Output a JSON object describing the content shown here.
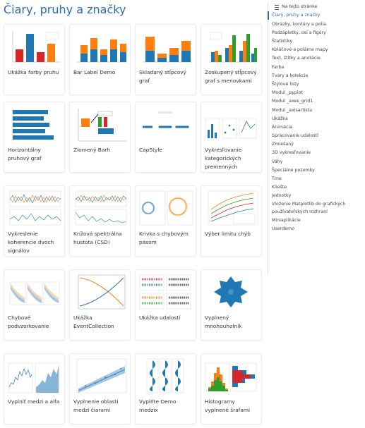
{
  "page": {
    "title": "Čiary, pruhy a značky"
  },
  "gallery": [
    {
      "label": "Ukážka farby pruhu",
      "thumb": "bar-color-thumbnail"
    },
    {
      "label": "Bar Label Demo",
      "thumb": "bar-label-thumbnail"
    },
    {
      "label": "Skladaný stĺpcový graf",
      "thumb": "stacked-bar-thumbnail"
    },
    {
      "label": "Zoskupený stĺpcový graf s menovkami",
      "thumb": "grouped-bar-thumbnail"
    },
    {
      "label": "Horizontálny pruhový graf",
      "thumb": "horizontal-bar-thumbnail"
    },
    {
      "label": "Zlomený Barh",
      "thumb": "broken-barh-thumbnail"
    },
    {
      "label": "CapStyle",
      "thumb": "capstyle-thumbnail"
    },
    {
      "label": "Vykresľovanie kategorických premenných",
      "thumb": "categorical-thumbnail"
    },
    {
      "label": "Vykreslenie koherencie dvoch signálov",
      "thumb": "coherence-thumbnail"
    },
    {
      "label": "Krížová spektrálna hustota (CSD)",
      "thumb": "csd-thumbnail"
    },
    {
      "label": "Krivka s chybovým pásom",
      "thumb": "error-band-thumbnail"
    },
    {
      "label": "Výber limitu chýb",
      "thumb": "errorbar-limits-thumbnail"
    },
    {
      "label": "Chybové podvzorkovanie",
      "thumb": "errorbar-subsample-thumbnail"
    },
    {
      "label": "Ukážka EventCollection",
      "thumb": "eventcollection-thumbnail"
    },
    {
      "label": "Ukážka udalostí",
      "thumb": "eventplot-thumbnail"
    },
    {
      "label": "Vyplnený mnohouholník",
      "thumb": "filled-polygon-thumbnail"
    },
    {
      "label": "Vyplniť medzi a alfa",
      "thumb": "fill-between-alpha-thumbnail"
    },
    {
      "label": "Vyplnenie oblasti medzi čiarami",
      "thumb": "fill-between-demo-thumbnail"
    },
    {
      "label": "Vyplňte Demo medzix",
      "thumb": "fill-betweenx-thumbnail"
    },
    {
      "label": "Histogramy vyplnené šrafami",
      "thumb": "hatched-histograms-thumbnail"
    }
  ],
  "sidebar": {
    "heading": "Na tejto stránke",
    "items": [
      "Čiary, pruhy a značky",
      "Obrázky, kontúry a polia",
      "Podzápletky, osi a figúry",
      "Štatistiky",
      "Koláčové a polárne mapy",
      "Text, štítky a anotácie",
      "Farba",
      "Tvary a kolekcie",
      "Štýlové listy",
      "Modul _pyplot",
      "Modul _axes_grid1",
      "Modul _axisartista",
      "Ukážka",
      "Animácia",
      "Spracovanie udalostí",
      "Zmiešaný",
      "3D vykresľovanie",
      "Váhy",
      "Špeciálne pozemky",
      "Tme",
      "Kliešte",
      "Jednotky",
      "Vloženie Matplotlib do grafických používateľských rozhraní",
      "Miniaplikácie",
      "Userdemo"
    ]
  },
  "colors": {
    "accent": "#2a6cb0",
    "blue": "#1f77b4",
    "orange": "#ff7f0e",
    "green": "#2ca02c",
    "red": "#d62728",
    "purple": "#9467bd"
  }
}
